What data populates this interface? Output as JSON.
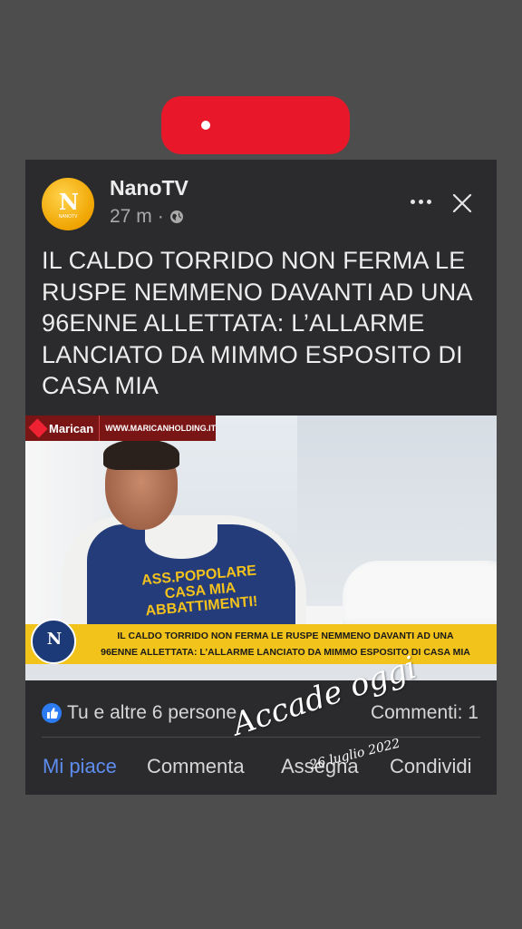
{
  "post": {
    "page_name": "NanoTV",
    "time_ago": "27 m",
    "separator": "·",
    "avatar_mark": "N",
    "avatar_sub": "NANOTV",
    "headline": "IL CALDO TORRIDO NON FERMA LE RUSPE NEMMENO DAVANTI AD UNA 96ENNE ALLETTATA: L’ALLARME LANCIATO DA MIMMO ESPOSITO DI CASA MIA"
  },
  "media": {
    "sponsor_name": "Marican",
    "sponsor_url": "WWW.MARICANHOLDING.IT",
    "vest_text": "ASS.POPOLARE CASA MIA ABBATTIMENTI!",
    "banner_logo": "N",
    "banner_line1": "IL CALDO TORRIDO NON FERMA LE RUSPE NEMMENO DAVANTI AD UNA",
    "banner_line2": "96ENNE ALLETTATA: L’ALLARME LANCIATO DA MIMMO ESPOSITO DI CASA MIA"
  },
  "stats": {
    "reactions_text": "Tu e altre 6 persone",
    "comments_text": "Commenti: 1"
  },
  "actions": {
    "like": "Mi piace",
    "comment": "Commenta",
    "watch": "Assegna",
    "share": "Condividi"
  },
  "watermark": {
    "title": "Accade oggi",
    "date": "26 luglio 2022"
  },
  "colors": {
    "background": "#4d4d4d",
    "card": "#2b2b2d",
    "record": "#e8182a",
    "like_active": "#5e8df0",
    "banner": "#f2c31a"
  },
  "icons": [
    "record-dot-icon",
    "globe-icon",
    "more-icon",
    "close-icon",
    "like-badge-icon"
  ]
}
